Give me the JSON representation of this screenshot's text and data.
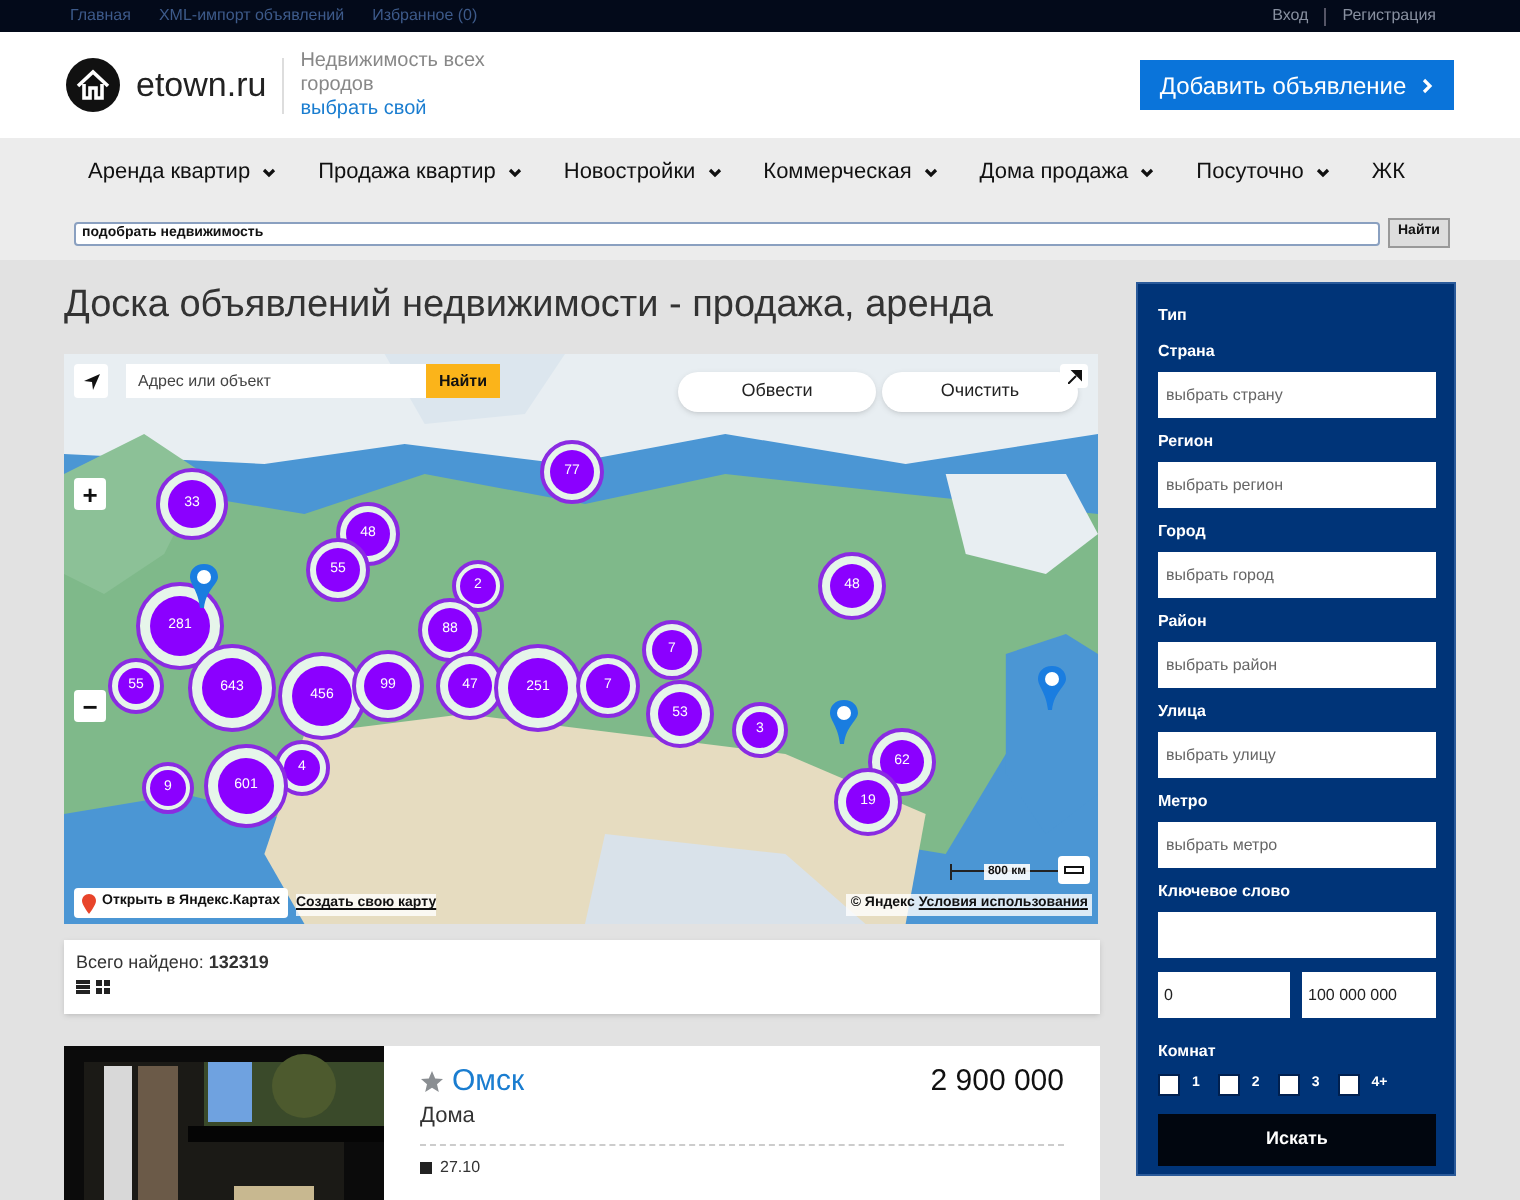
{
  "top_links": [
    "Главная",
    "XML-импорт объявлений",
    "Избранное (0)"
  ],
  "auth_links": [
    "Вход",
    "Регистрация"
  ],
  "header": {
    "site_name": "etown.ru",
    "tagline": "Недвижимость всех городов",
    "city_link": "выбрать свой",
    "add_button": "Добавить объявление"
  },
  "nav": [
    {
      "label": "Аренда квартир",
      "dropdown": true
    },
    {
      "label": "Продажа квартир",
      "dropdown": true
    },
    {
      "label": "Новостройки",
      "dropdown": true
    },
    {
      "label": "Коммерческая",
      "dropdown": true
    },
    {
      "label": "Дома продажа",
      "dropdown": true
    },
    {
      "label": "Посуточно",
      "dropdown": true
    },
    {
      "label": "ЖК",
      "dropdown": false
    }
  ],
  "site_search": {
    "value": "подобрать недвижимость",
    "button": "Найти"
  },
  "page_title": "Доска объявлений недвижимости - продажа, аренда",
  "map": {
    "search_placeholder": "Адрес или объект",
    "search_button": "Найти",
    "draw_button": "Обвести",
    "clear_button": "Очистить",
    "zoom_in": "+",
    "zoom_out": "−",
    "clusters": [
      "33",
      "77",
      "48",
      "55",
      "2",
      "281",
      "88",
      "48",
      "7",
      "55",
      "643",
      "456",
      "99",
      "47",
      "251",
      "7",
      "53",
      "3",
      "62",
      "19",
      "4",
      "9",
      "601"
    ],
    "open_button": "Открыть в Яндекс.Картах",
    "create_link": "Создать свою карту",
    "scale": "800 км",
    "copyright": "© Яндекс",
    "terms_link": "Условия использования"
  },
  "results": {
    "total": "Всего найдено: **132319**"
  },
  "listing": {
    "city": "Омск",
    "type": "Дома",
    "price": "2 900 000",
    "date": "27.10"
  },
  "filters": {
    "type_label": "Тип",
    "fields": [
      {
        "label": "Страна",
        "placeholder": "выбрать страну"
      },
      {
        "label": "Регион",
        "placeholder": "выбрать регион"
      },
      {
        "label": "Город",
        "placeholder": "выбрать город"
      },
      {
        "label": "Район",
        "placeholder": "выбрать район"
      },
      {
        "label": "Улица",
        "placeholder": "выбрать улицу"
      },
      {
        "label": "Метро",
        "placeholder": "выбрать метро"
      },
      {
        "label": "Ключевое слово"
      }
    ],
    "price_from": "0",
    "price_to": "100 000 000",
    "rooms_label": "Комнат",
    "rooms": [
      {
        "label": "1",
        "checked": false
      },
      {
        "label": "2",
        "checked": false
      },
      {
        "label": "3",
        "checked": false
      },
      {
        "label": "4+",
        "checked": false
      }
    ],
    "search_button": "Искать"
  }
}
